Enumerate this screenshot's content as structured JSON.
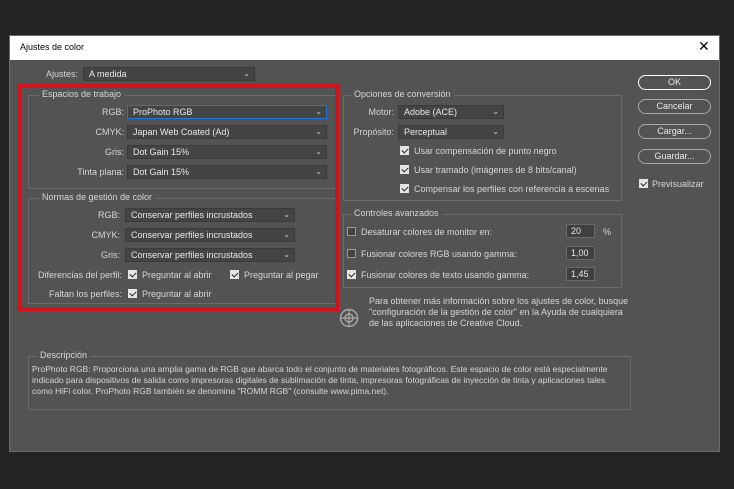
{
  "dialog": {
    "title": "Ajustes de color",
    "close_glyph": "✕"
  },
  "settings": {
    "label": "Ajustes:",
    "value": "A medida"
  },
  "working_spaces": {
    "title": "Espacios de trabajo",
    "rgb": {
      "label": "RGB:",
      "value": "ProPhoto RGB"
    },
    "cmyk": {
      "label": "CMYK:",
      "value": "Japan Web Coated (Ad)"
    },
    "gray": {
      "label": "Gris:",
      "value": "Dot Gain 15%"
    },
    "spot": {
      "label": "Tinta plana:",
      "value": "Dot Gain 15%"
    }
  },
  "policies": {
    "title": "Normas de gestión de color",
    "rgb": {
      "label": "RGB:",
      "value": "Conservar perfiles incrustados"
    },
    "cmyk": {
      "label": "CMYK:",
      "value": "Conservar perfiles incrustados"
    },
    "gray": {
      "label": "Gris:",
      "value": "Conservar perfiles incrustados"
    },
    "mismatch": {
      "label": "Diferencias del perfil:",
      "ask_open": "Preguntar al abrir",
      "ask_paste": "Preguntar al pegar",
      "ask_open_checked": true,
      "ask_paste_checked": true
    },
    "missing": {
      "label": "Faltan los perfiles:",
      "ask_open": "Preguntar al abrir",
      "ask_open_checked": true
    }
  },
  "conversion": {
    "title": "Opciones de conversión",
    "engine": {
      "label": "Motor:",
      "value": "Adobe (ACE)"
    },
    "intent": {
      "label": "Propósito:",
      "value": "Perceptual"
    },
    "black_point": {
      "label": "Usar compensación de punto negro",
      "checked": true
    },
    "dither": {
      "label": "Usar tramado (imágenes de 8 bits/canal)",
      "checked": true
    },
    "compensate": {
      "label": "Compensar los perfiles con referencia a escenas",
      "checked": true
    }
  },
  "advanced": {
    "title": "Controles avanzados",
    "desaturate": {
      "label": "Desaturar colores de monitor en:",
      "value": "20",
      "unit": "%",
      "checked": false
    },
    "blend_rgb": {
      "label": "Fusionar colores RGB usando gamma:",
      "value": "1,00",
      "checked": false
    },
    "blend_text": {
      "label": "Fusionar colores de texto usando gamma:",
      "value": "1,45",
      "checked": true
    }
  },
  "info": {
    "text": "Para obtener más información sobre los ajustes de color, busque \"configuración de la gestión de color\" en la Ayuda de cualquiera de las aplicaciones de Creative Cloud."
  },
  "description": {
    "title": "Descripción",
    "text": "ProPhoto RGB: Proporciona una amplia gama de RGB que abarca todo el conjunto de materiales fotográficos. Este espacio de color está especialmente indicado para dispositivos de salida como impresoras digitales de sublimación de tinta, impresoras fotográficas de inyección de tinta y aplicaciones tales como HiFi color. ProPhoto RGB también se denomina \"ROMM RGB\" (consulte www.pima.net)."
  },
  "buttons": {
    "ok": "OK",
    "cancel": "Cancelar",
    "load": "Cargar...",
    "save": "Guardar...",
    "preview": {
      "label": "Previsualizar",
      "checked": true
    }
  },
  "colors": {
    "highlight": "#d2131b",
    "dialog_bg": "#535353",
    "focus": "#1f74d6"
  }
}
